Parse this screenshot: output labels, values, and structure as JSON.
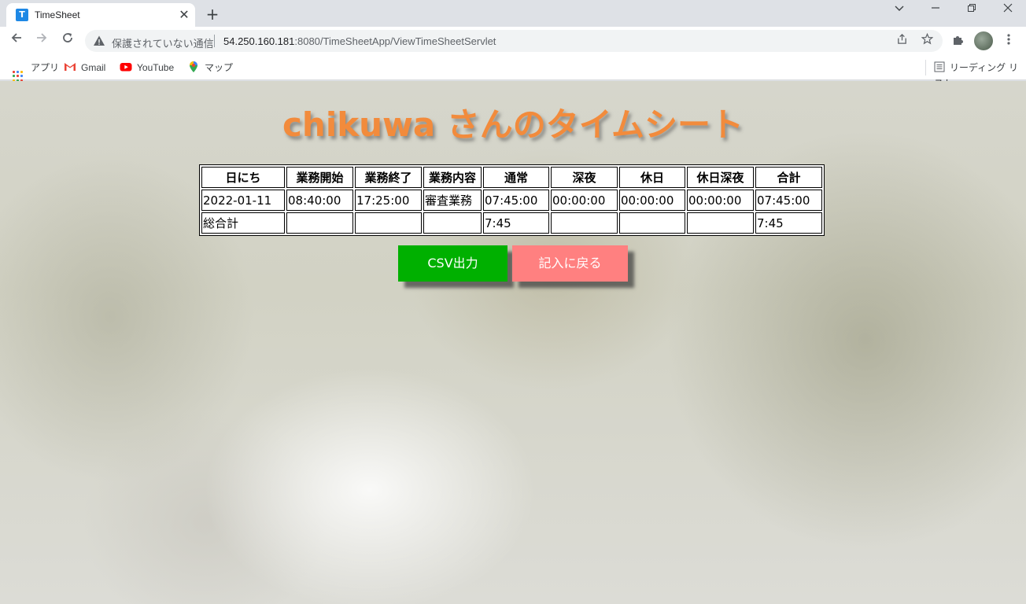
{
  "browser": {
    "tab": {
      "title": "TimeSheet",
      "favicon_letter": "T"
    },
    "new_tab_symbol": "+",
    "address": {
      "security_text": "保護されていない通信",
      "url_host": "54.250.160.181",
      "url_rest": ":8080/TimeSheetApp/ViewTimeSheetServlet"
    },
    "bookmarks": [
      {
        "label": "アプリ",
        "icon": "apps-grid-icon"
      },
      {
        "label": "Gmail",
        "icon": "gmail-icon"
      },
      {
        "label": "YouTube",
        "icon": "youtube-icon"
      },
      {
        "label": "マップ",
        "icon": "maps-pin-icon"
      }
    ],
    "reading_list": "リーディング リスト"
  },
  "page": {
    "title": "chikuwa さんのタイムシート",
    "table": {
      "headers": [
        "日にち",
        "業務開始",
        "業務終了",
        "業務内容",
        "通常",
        "深夜",
        "休日",
        "休日深夜",
        "合計"
      ],
      "rows": [
        [
          "2022-01-11",
          "08:40:00",
          "17:25:00",
          "審査業務",
          "07:45:00",
          "00:00:00",
          "00:00:00",
          "00:00:00",
          "07:45:00"
        ],
        [
          "総合計",
          "",
          "",
          "",
          "7:45",
          "",
          "",
          "",
          "7:45"
        ]
      ]
    },
    "buttons": {
      "csv": "CSV出力",
      "back": "記入に戻る"
    }
  },
  "colors": {
    "title": "#f28b3c",
    "csv_button": "#00b000",
    "back_button": "#ff8080"
  }
}
